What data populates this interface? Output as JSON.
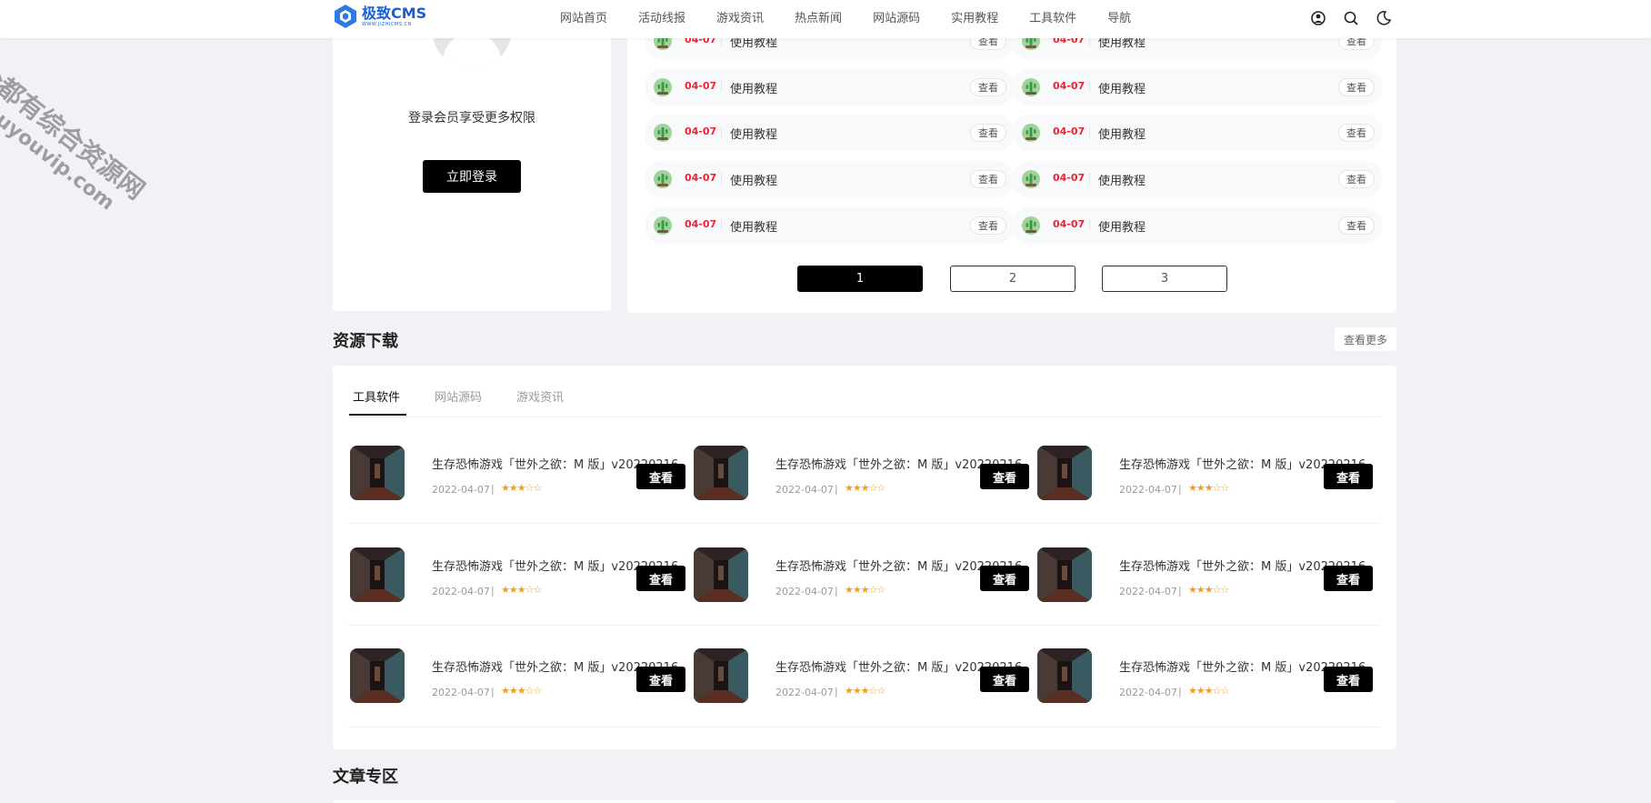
{
  "header": {
    "logo_text": "极致CMS",
    "logo_sub": "WWW.JIZHICMS.CN",
    "nav": [
      "网站首页",
      "活动线报",
      "游戏资讯",
      "热点新闻",
      "网站源码",
      "实用教程",
      "工具软件",
      "导航"
    ]
  },
  "login_card": {
    "text": "登录会员享受更多权限",
    "button": "立即登录"
  },
  "tutorial_list": {
    "rows": [
      {
        "date": "04-07",
        "title": "使用教程",
        "view": "查看"
      },
      {
        "date": "04-07",
        "title": "使用教程",
        "view": "查看"
      },
      {
        "date": "04-07",
        "title": "使用教程",
        "view": "查看"
      },
      {
        "date": "04-07",
        "title": "使用教程",
        "view": "查看"
      },
      {
        "date": "04-07",
        "title": "使用教程",
        "view": "查看"
      },
      {
        "date": "04-07",
        "title": "使用教程",
        "view": "查看"
      },
      {
        "date": "04-07",
        "title": "使用教程",
        "view": "查看"
      },
      {
        "date": "04-07",
        "title": "使用教程",
        "view": "查看"
      },
      {
        "date": "04-07",
        "title": "使用教程",
        "view": "查看"
      },
      {
        "date": "04-07",
        "title": "使用教程",
        "view": "查看"
      }
    ],
    "pages": [
      "1",
      "2",
      "3"
    ],
    "current_page": "1"
  },
  "downloads": {
    "title": "资源下载",
    "more": "查看更多",
    "tabs": [
      "工具软件",
      "网站源码",
      "游戏资讯"
    ],
    "active_tab": "工具软件",
    "items": [
      {
        "title": "生存恐怖游戏「世外之欲：M 版」v20220216",
        "date": "2022-04-07",
        "rating": 3,
        "button": "查看"
      },
      {
        "title": "生存恐怖游戏「世外之欲：M 版」v20220216",
        "date": "2022-04-07",
        "rating": 3,
        "button": "查看"
      },
      {
        "title": "生存恐怖游戏「世外之欲：M 版」v20220216",
        "date": "2022-04-07",
        "rating": 3,
        "button": "查看"
      },
      {
        "title": "生存恐怖游戏「世外之欲：M 版」v20220216",
        "date": "2022-04-07",
        "rating": 3,
        "button": "查看"
      },
      {
        "title": "生存恐怖游戏「世外之欲：M 版」v20220216",
        "date": "2022-04-07",
        "rating": 3,
        "button": "查看"
      },
      {
        "title": "生存恐怖游戏「世外之欲：M 版」v20220216",
        "date": "2022-04-07",
        "rating": 3,
        "button": "查看"
      },
      {
        "title": "生存恐怖游戏「世外之欲：M 版」v20220216",
        "date": "2022-04-07",
        "rating": 3,
        "button": "查看"
      },
      {
        "title": "生存恐怖游戏「世外之欲：M 版」v20220216",
        "date": "2022-04-07",
        "rating": 3,
        "button": "查看"
      },
      {
        "title": "生存恐怖游戏「世外之欲：M 版」v20220216",
        "date": "2022-04-07",
        "rating": 3,
        "button": "查看"
      }
    ]
  },
  "articles": {
    "title": "文章专区"
  },
  "watermark": {
    "line1": "全都有综合资源网",
    "line2": "douyouvip.com"
  },
  "colors": {
    "date_red": "#e22233",
    "star_gold": "#f0a020",
    "brand_blue": "#1a5fd8"
  }
}
